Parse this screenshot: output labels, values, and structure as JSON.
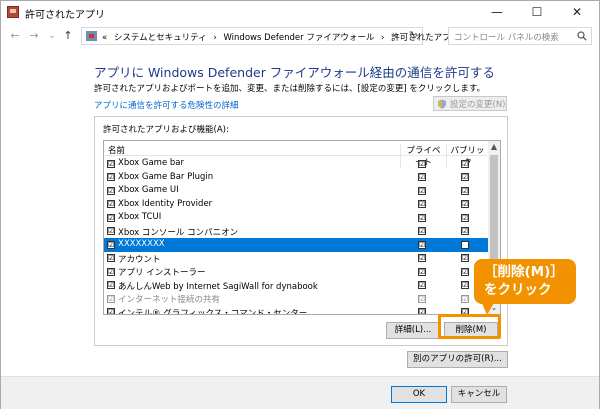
{
  "window": {
    "title": "許可されたアプリ",
    "minimize_glyph": "—",
    "maximize_glyph": "☐",
    "close_glyph": "✕"
  },
  "nav": {
    "back": "←",
    "forward": "→",
    "dropdown": "⌄",
    "up": "↑"
  },
  "address": {
    "sep": "«",
    "crumbs": [
      "システムとセキュリティ",
      "›",
      "Windows Defender ファイアウォール",
      "›",
      "許可されたアプリ"
    ],
    "chevron": "⌄",
    "refresh": "↻"
  },
  "search": {
    "placeholder": "コントロール パネルの検索"
  },
  "main": {
    "heading": "アプリに Windows Defender ファイアウォール経由の通信を許可する",
    "description": "許可されたアプリおよびポートを追加、変更、または削除するには、[設定の変更] をクリックします。",
    "risk_link": "アプリに通信を許可する危険性の詳細",
    "change_settings": "設定の変更(N)",
    "group_label": "許可されたアプリおよび機能(A):",
    "columns": {
      "name": "名前",
      "private": "プライベート",
      "public": "パブリック"
    },
    "rows": [
      {
        "name": "Xbox Game bar",
        "check": "☑",
        "private": "☑",
        "public": "☑",
        "selected": false,
        "disabled": false
      },
      {
        "name": "Xbox Game Bar Plugin",
        "check": "☑",
        "private": "☑",
        "public": "☑",
        "selected": false,
        "disabled": false
      },
      {
        "name": "Xbox Game UI",
        "check": "☑",
        "private": "☑",
        "public": "☑",
        "selected": false,
        "disabled": false
      },
      {
        "name": "Xbox Identity Provider",
        "check": "☑",
        "private": "☑",
        "public": "☑",
        "selected": false,
        "disabled": false
      },
      {
        "name": "Xbox TCUI",
        "check": "☑",
        "private": "☑",
        "public": "☑",
        "selected": false,
        "disabled": false
      },
      {
        "name": "Xbox コンソール コンパニオン",
        "check": "☑",
        "private": "☑",
        "public": "☑",
        "selected": false,
        "disabled": false
      },
      {
        "name": "XXXXXXXX",
        "check": "☑",
        "private": "☑",
        "public": "",
        "selected": true,
        "disabled": false
      },
      {
        "name": "アカウント",
        "check": "☑",
        "private": "☑",
        "public": "☑",
        "selected": false,
        "disabled": false
      },
      {
        "name": "アプリ インストーラー",
        "check": "☑",
        "private": "☑",
        "public": "☑",
        "selected": false,
        "disabled": false
      },
      {
        "name": "あんしんWeb by Internet SagiWall for dynabook",
        "check": "☑",
        "private": "☑",
        "public": "☑",
        "selected": false,
        "disabled": false
      },
      {
        "name": "インターネット接続の共有",
        "check": "☑",
        "private": "☑",
        "public": "☑",
        "selected": false,
        "disabled": true
      },
      {
        "name": "インテル® グラフィックス・コマンド・センター",
        "check": "☑",
        "private": "☑",
        "public": "☑",
        "selected": false,
        "disabled": false
      }
    ],
    "scroll_up": "▲",
    "scroll_down": "⌄",
    "details_button": "詳細(L)...",
    "remove_button": "削除(M)",
    "allow_other_button": "別のアプリの許可(R)..."
  },
  "footer": {
    "ok": "OK",
    "cancel": "キャンセル"
  },
  "callout": {
    "line1": "［削除(M)］",
    "line2": "をクリック"
  },
  "colors": {
    "accent": "#0078d7",
    "callout": "#f39200",
    "heading": "#1e3a8a",
    "link": "#0066cc"
  }
}
